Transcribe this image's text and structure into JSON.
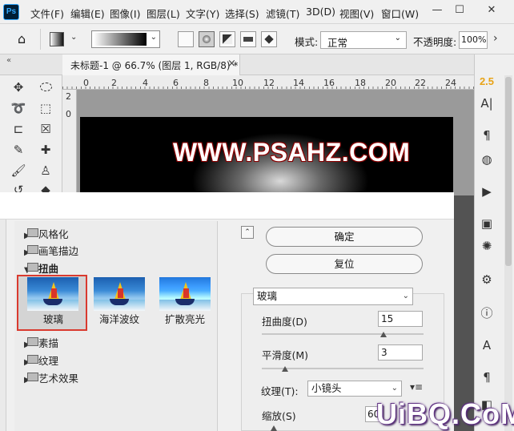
{
  "app": {
    "logo_text": "Ps"
  },
  "menu": [
    "文件(F)",
    "编辑(E)",
    "图像(I)",
    "图层(L)",
    "文字(Y)",
    "选择(S)",
    "滤镜(T)",
    "3D(D)",
    "视图(V)",
    "窗口(W)"
  ],
  "window_controls": {
    "minimize": "—",
    "maximize": "☐",
    "close": "✕"
  },
  "options_bar": {
    "mode_label": "模式:",
    "mode_value": "正常",
    "opacity_label": "不透明度:",
    "opacity_value": "100%"
  },
  "document_tab": {
    "title": "未标题-1 @ 66.7% (图层 1, RGB/8) *",
    "close": "×"
  },
  "ruler": {
    "top_numbers": [
      "0",
      "2",
      "4",
      "6",
      "8",
      "10",
      "12",
      "14",
      "16",
      "18",
      "20",
      "22",
      "24"
    ],
    "left_numbers": [
      "2",
      "0"
    ]
  },
  "canvas": {
    "text": "WWW.PSAHZ.COM"
  },
  "right_panel": {
    "char_size": "2.5",
    "char_icon": "A|",
    "paragraph_icon": "¶"
  },
  "filter_gallery": {
    "categories": [
      {
        "label": "风格化",
        "expanded": false
      },
      {
        "label": "画笔描边",
        "expanded": false
      },
      {
        "label": "扭曲",
        "expanded": true
      },
      {
        "label": "素描",
        "expanded": false
      },
      {
        "label": "纹理",
        "expanded": false
      },
      {
        "label": "艺术效果",
        "expanded": false
      }
    ],
    "thumbnails": [
      {
        "label": "玻璃",
        "selected": true
      },
      {
        "label": "海洋波纹",
        "selected": false
      },
      {
        "label": "扩散亮光",
        "selected": false
      }
    ],
    "ok_button": "确定",
    "reset_button": "复位",
    "selected_filter": "玻璃",
    "params": {
      "distortion_label": "扭曲度(D)",
      "distortion_value": "15",
      "distortion_level": 15,
      "smoothness_label": "平滑度(M)",
      "smoothness_value": "3",
      "smoothness_level": 3,
      "texture_label": "纹理(T):",
      "texture_value": "小镜头",
      "scale_label": "缩放(S)",
      "scale_value": "60"
    }
  },
  "colors": {
    "selection_border": "#d93a2f",
    "accent_orange": "#e8a317",
    "ps_blue": "#31a8ff"
  },
  "watermark": {
    "text": "UiBQ.CoM"
  }
}
